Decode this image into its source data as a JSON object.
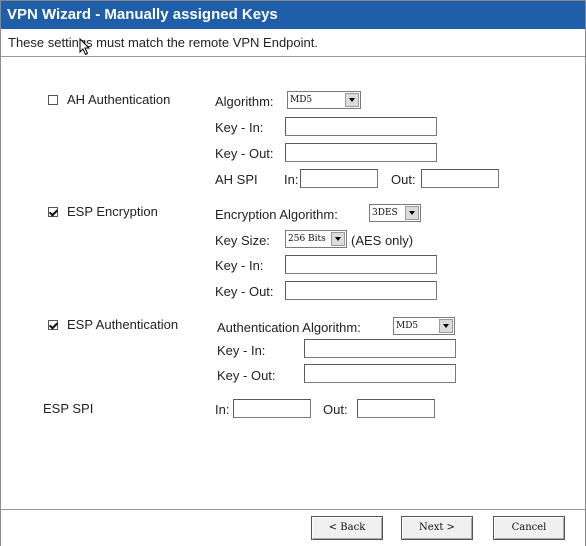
{
  "window": {
    "title": "VPN Wizard - Manually assigned Keys",
    "subtitle": "These settings must match the remote VPN Endpoint."
  },
  "ah": {
    "checkbox_label": "AH Authentication",
    "checked": false,
    "algorithm_label": "Algorithm:",
    "algorithm_value": "MD5",
    "key_in_label": "Key - In:",
    "key_in_value": "",
    "key_out_label": "Key - Out:",
    "key_out_value": "",
    "spi_label": "AH SPI",
    "spi_in_label": "In:",
    "spi_in_value": "",
    "spi_out_label": "Out:",
    "spi_out_value": ""
  },
  "esp_enc": {
    "checkbox_label": "ESP Encryption",
    "checked": true,
    "algorithm_label": "Encryption Algorithm:",
    "algorithm_value": "3DES",
    "key_size_label": "Key Size:",
    "key_size_value": "256 Bits",
    "key_size_note": "(AES only)",
    "key_in_label": "Key - In:",
    "key_in_value": "",
    "key_out_label": "Key - Out:",
    "key_out_value": ""
  },
  "esp_auth": {
    "checkbox_label": "ESP Authentication",
    "checked": true,
    "algorithm_label": "Authentication Algorithm:",
    "algorithm_value": "MD5",
    "key_in_label": "Key - In:",
    "key_in_value": "",
    "key_out_label": "Key - Out:",
    "key_out_value": ""
  },
  "esp_spi": {
    "label": "ESP SPI",
    "in_label": "In:",
    "in_value": "",
    "out_label": "Out:",
    "out_value": ""
  },
  "footer": {
    "back_label": "< Back",
    "next_label": "Next >",
    "cancel_label": "Cancel"
  }
}
